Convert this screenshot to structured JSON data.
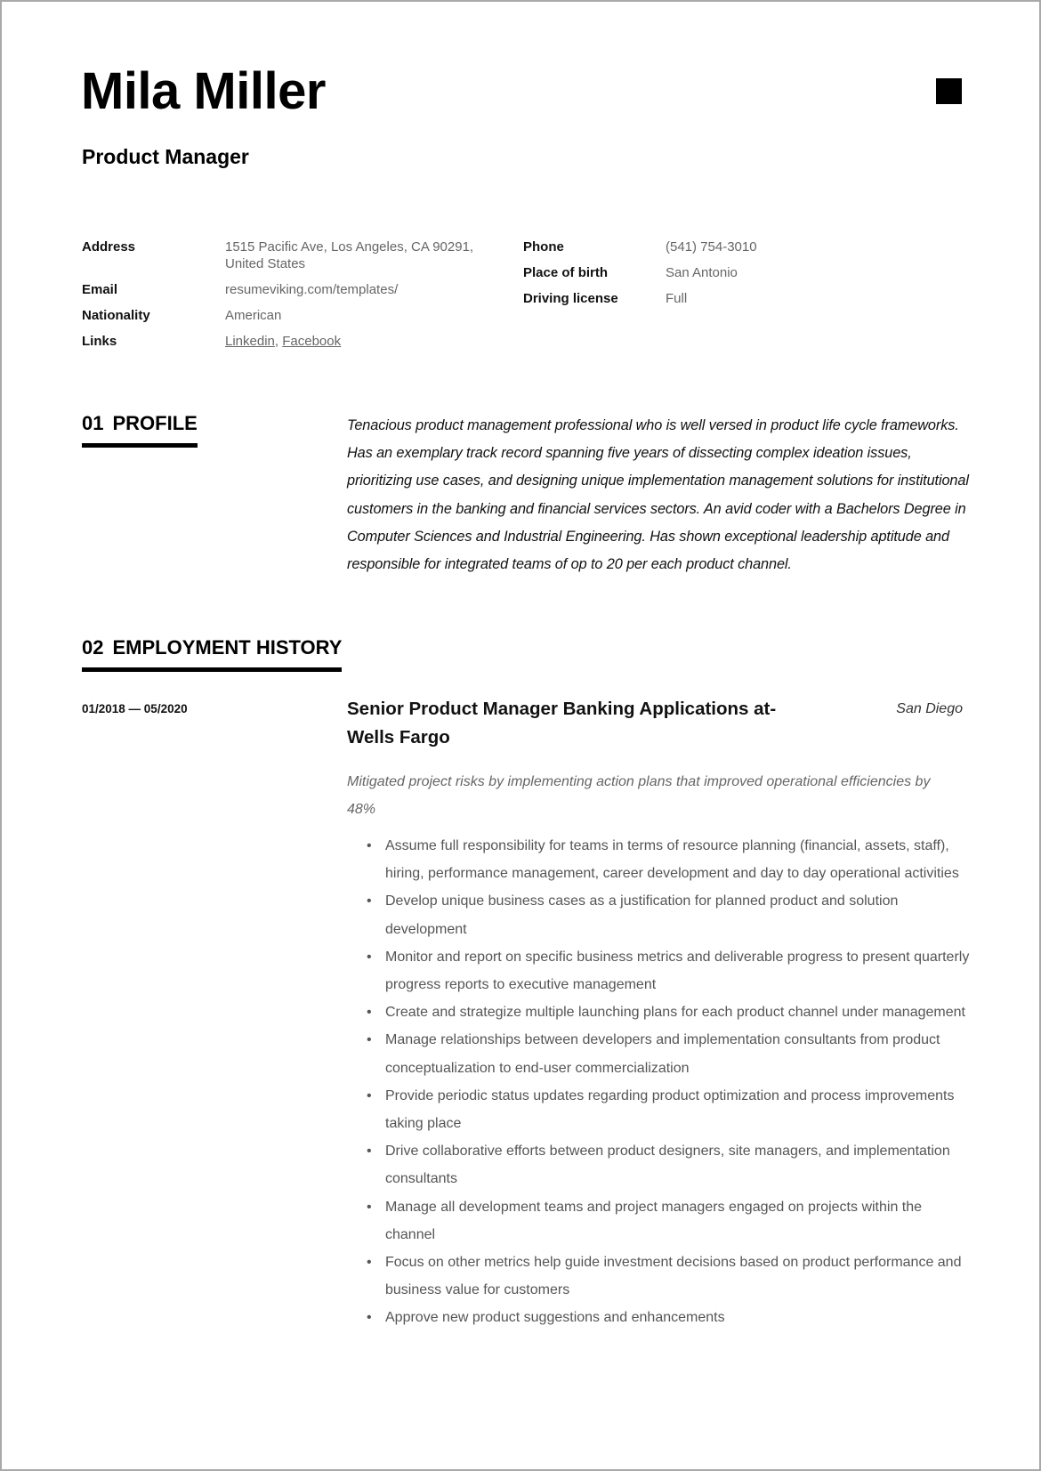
{
  "header": {
    "name": "Mila Miller",
    "job_title": "Product Manager"
  },
  "details": {
    "left": [
      {
        "label": "Address",
        "value": "1515 Pacific Ave, Los Angeles, CA 90291, United States"
      },
      {
        "label": "Email",
        "value": "resumeviking.com/templates/"
      },
      {
        "label": "Nationality",
        "value": "American"
      }
    ],
    "links": {
      "label": "Links",
      "items": [
        "Linkedin",
        "Facebook"
      ],
      "separator": ", "
    },
    "right": [
      {
        "label": "Phone",
        "value": "(541) 754-3010"
      },
      {
        "label": "Place of birth",
        "value": "San Antonio"
      },
      {
        "label": "Driving license",
        "value": "Full"
      }
    ]
  },
  "profile": {
    "number": "01",
    "heading": "PROFILE",
    "text": "Tenacious product management professional who is well versed in product life cycle frameworks. Has an exemplary track record spanning five years of dissecting complex ideation issues, prioritizing use cases, and designing unique implementation management solutions for institutional customers in the banking and financial services sectors. An avid coder with a Bachelors Degree in Computer Sciences and Industrial Engineering. Has shown exceptional leadership aptitude and responsible for integrated teams of op to 20 per each product channel."
  },
  "employment": {
    "number": "02",
    "heading": "EMPLOYMENT HISTORY",
    "jobs": [
      {
        "dates": "01/2018 — 05/2020",
        "role": "Senior Product Manager Banking Applications at- Wells Fargo",
        "city": "San Diego",
        "summary": "Mitigated project risks by implementing action plans that improved operational efficiencies by 48%",
        "bullet_symbol": "•",
        "bullets": [
          "Assume full responsibility for teams in terms of resource planning (financial, assets, staff), hiring, performance management, career development and day to day operational activities",
          "Develop unique business cases as a justification for planned product and solution development",
          "Monitor and report on specific business metrics and deliverable progress to present quarterly progress reports to executive management",
          "Create and strategize multiple launching plans for each product channel under management",
          "Manage relationships between developers and implementation consultants from product conceptualization to end-user commercialization",
          "Provide periodic status updates regarding product optimization and process improvements taking place",
          "Drive collaborative efforts between product designers, site managers, and implementation consultants",
          "Manage all development teams and project managers engaged on projects within the channel",
          "Focus on other metrics help guide investment decisions based on product performance and business value for customers",
          "Approve new product suggestions and enhancements"
        ]
      }
    ]
  }
}
